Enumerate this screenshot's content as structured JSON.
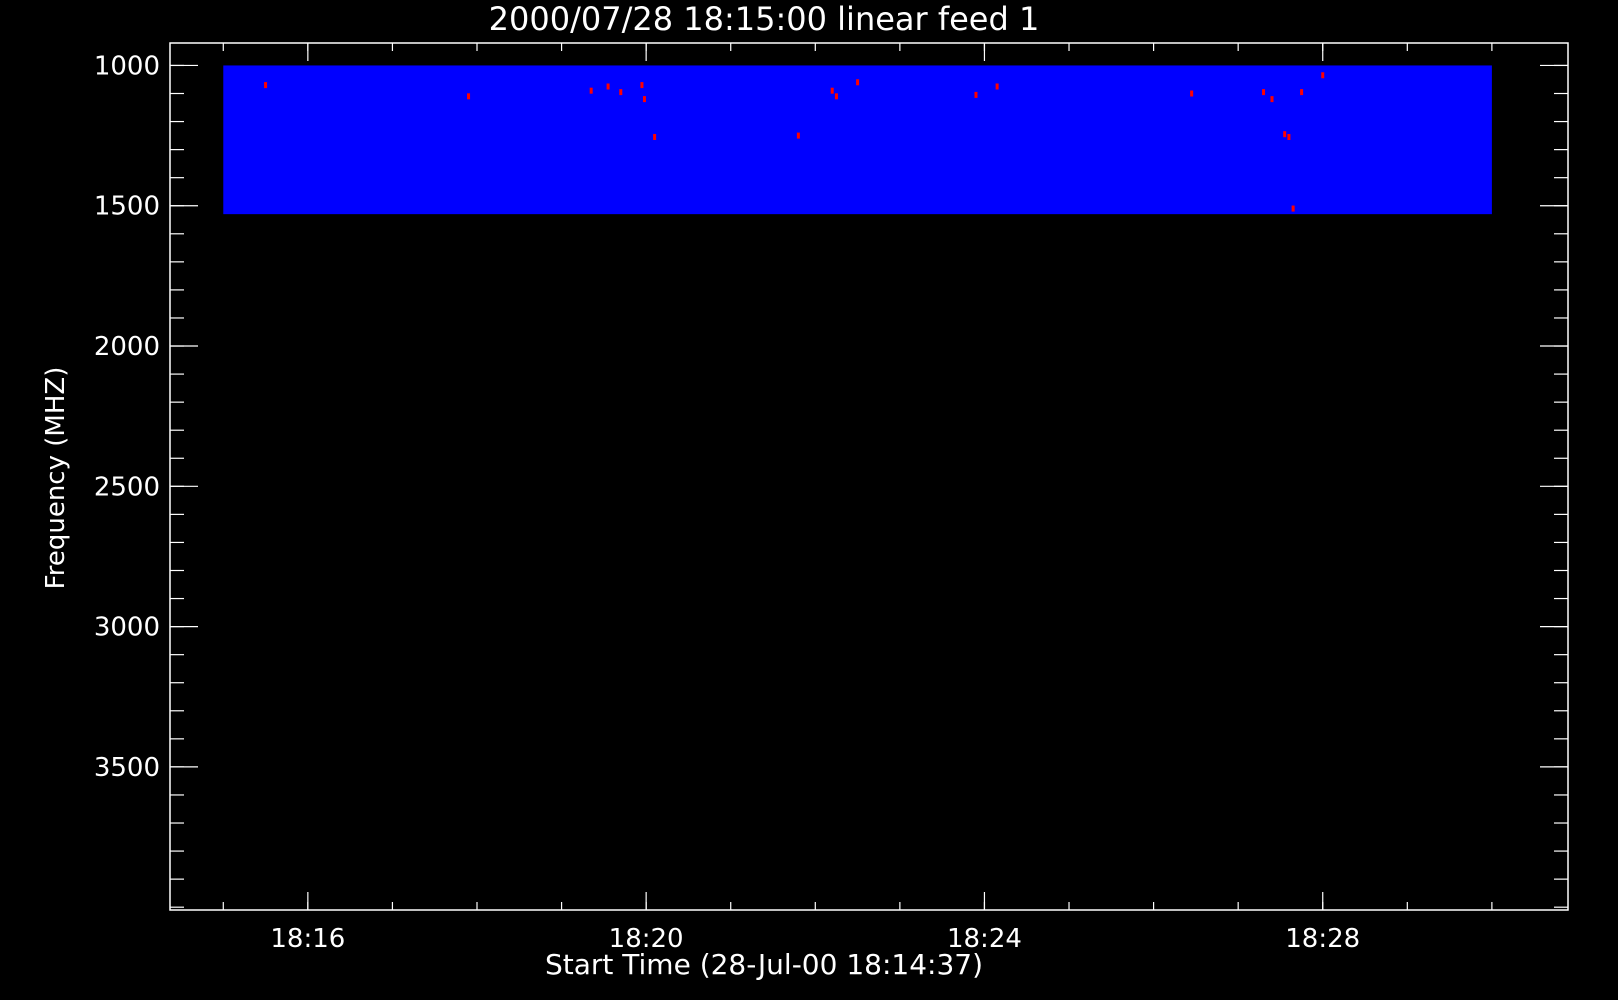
{
  "chart_data": {
    "type": "heatmap",
    "title": "2000/07/28 18:15:00 linear feed 1",
    "xlabel": "Start Time (28-Jul-00 18:14:37)",
    "ylabel": "Frequency (MHZ)",
    "x_axis": {
      "unit": "minutes past 18:00",
      "range": [
        14.37,
        30.9
      ],
      "ticks": [
        {
          "value": 16,
          "label": "18:16"
        },
        {
          "value": 20,
          "label": "18:20"
        },
        {
          "value": 24,
          "label": "18:24"
        },
        {
          "value": 28,
          "label": "18:28"
        }
      ],
      "minor_step": 1
    },
    "y_axis": {
      "inverted": true,
      "range": [
        920,
        4010
      ],
      "ticks": [
        {
          "value": 1000,
          "label": "1000"
        },
        {
          "value": 1500,
          "label": "1500"
        },
        {
          "value": 2000,
          "label": "2000"
        },
        {
          "value": 2500,
          "label": "2500"
        },
        {
          "value": 3000,
          "label": "3000"
        },
        {
          "value": 3500,
          "label": "3500"
        }
      ],
      "minor_step": 100
    },
    "data_region": {
      "time_range": [
        15.0,
        30.0
      ],
      "freq_range": [
        1000,
        1530
      ],
      "background_color": "#0000ff"
    },
    "hotspots": [
      {
        "t": 15.5,
        "f": 1070
      },
      {
        "t": 17.9,
        "f": 1110
      },
      {
        "t": 19.35,
        "f": 1090
      },
      {
        "t": 19.55,
        "f": 1075
      },
      {
        "t": 19.7,
        "f": 1095
      },
      {
        "t": 19.95,
        "f": 1070
      },
      {
        "t": 19.98,
        "f": 1120
      },
      {
        "t": 20.1,
        "f": 1255
      },
      {
        "t": 21.8,
        "f": 1250
      },
      {
        "t": 22.2,
        "f": 1090
      },
      {
        "t": 22.25,
        "f": 1110
      },
      {
        "t": 22.5,
        "f": 1060
      },
      {
        "t": 23.9,
        "f": 1105
      },
      {
        "t": 24.15,
        "f": 1075
      },
      {
        "t": 26.45,
        "f": 1100
      },
      {
        "t": 27.3,
        "f": 1095
      },
      {
        "t": 27.4,
        "f": 1120
      },
      {
        "t": 27.55,
        "f": 1245
      },
      {
        "t": 27.6,
        "f": 1255
      },
      {
        "t": 27.65,
        "f": 1510
      },
      {
        "t": 27.75,
        "f": 1095
      },
      {
        "t": 28.0,
        "f": 1035
      }
    ],
    "colors": {
      "background": "#000000",
      "axes": "#ffffff",
      "data_fill": "#0000ff",
      "hotspot": "#ff0000"
    }
  }
}
